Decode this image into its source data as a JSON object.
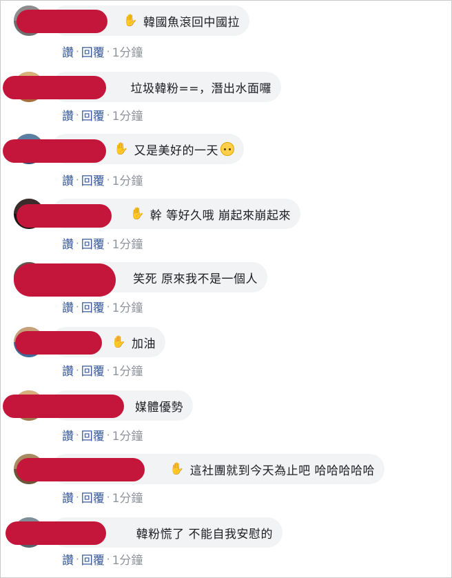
{
  "actions": {
    "like_label": "讚",
    "reply_label": "回覆",
    "separator": "·",
    "time_label": "1分鐘"
  },
  "comments": [
    {
      "text": "韓國魚滾回中國拉",
      "emoji": false,
      "hand": true
    },
    {
      "text": "垃圾韓粉==，潛出水面囉",
      "emoji": false,
      "hand": false
    },
    {
      "text": "又是美好的一天",
      "emoji": true,
      "hand": true
    },
    {
      "text": "幹 等好久哦 崩起來崩起來",
      "emoji": false,
      "hand": true
    },
    {
      "text": "笑死 原來我不是一個人",
      "emoji": false,
      "hand": false
    },
    {
      "text": "加油",
      "emoji": false,
      "hand": true
    },
    {
      "text": "媒體優勢",
      "emoji": false,
      "hand": false
    },
    {
      "text": "這社團就到今天為止吧 哈哈哈哈哈",
      "emoji": false,
      "hand": true
    },
    {
      "text": "韓粉慌了 不能自我安慰的",
      "emoji": false,
      "hand": false
    }
  ],
  "icons": {
    "hand": "raised-hand-icon",
    "emoji": "pleading-face-emoji"
  },
  "colors": {
    "redaction": "#c4163b",
    "link": "#365899",
    "bubble": "#f2f3f5",
    "meta": "#90949c"
  }
}
